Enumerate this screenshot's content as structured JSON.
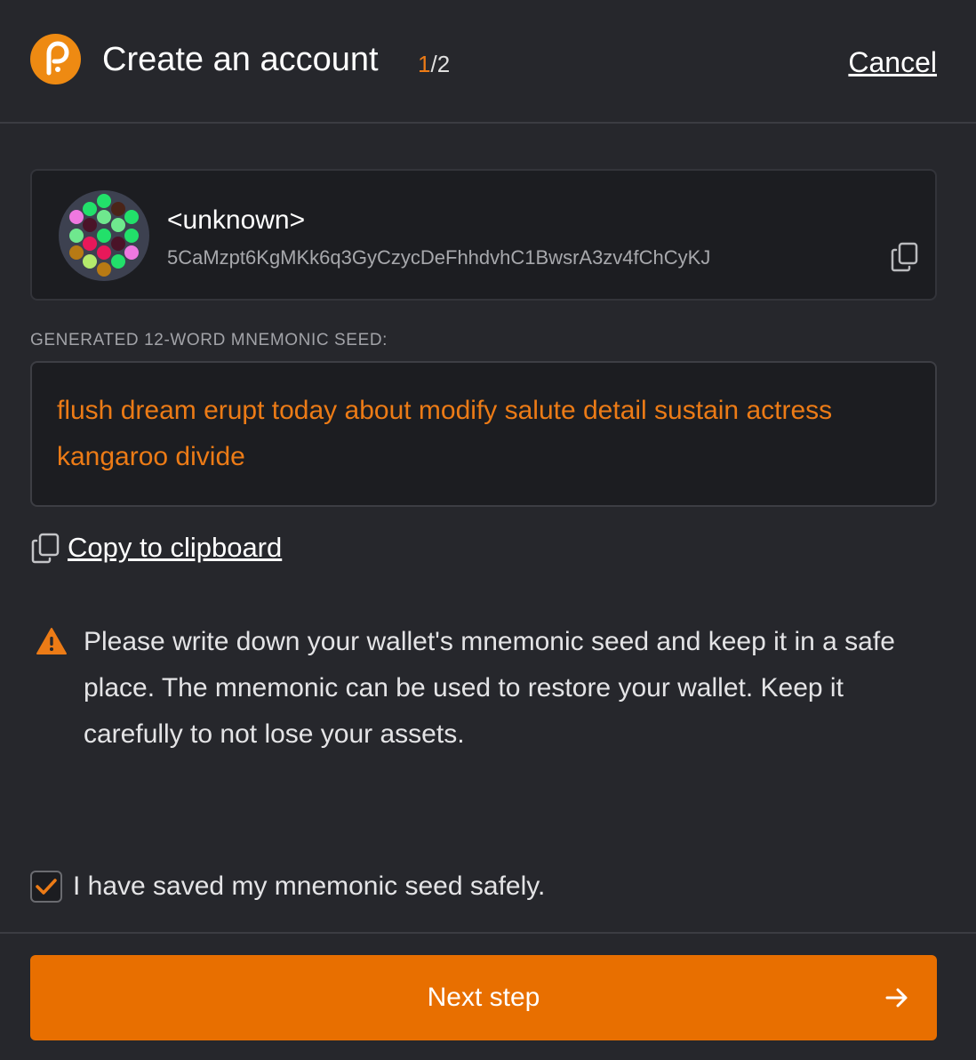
{
  "header": {
    "title": "Create an account",
    "step_current": "1",
    "step_total": "/2",
    "cancel_label": "Cancel"
  },
  "account": {
    "name": "<unknown>",
    "address": "5CaMzpt6KgMKk6q3GyCzycDeFhhdvhC1BwsrA3zv4fChCyKJ",
    "copy_icon": "copy-icon"
  },
  "seed": {
    "label": "GENERATED 12-WORD MNEMONIC SEED:",
    "phrase": "flush dream erupt today about modify salute detail sustain actress kangaroo divide",
    "copy_label": "Copy to clipboard"
  },
  "warning": {
    "icon": "warning-icon",
    "text": "Please write down your wallet's mnemonic seed and keep it in a safe place. The mnemonic can be used to restore your wallet. Keep it carefully to not lose your assets."
  },
  "confirm": {
    "checked": true,
    "label": "I have saved my mnemonic seed safely."
  },
  "next_button": {
    "label": "Next step",
    "icon": "arrow-right-icon"
  },
  "colors": {
    "accent": "#ec7b16",
    "button": "#e86f00",
    "background": "#26272c",
    "panel": "#1c1d21"
  }
}
